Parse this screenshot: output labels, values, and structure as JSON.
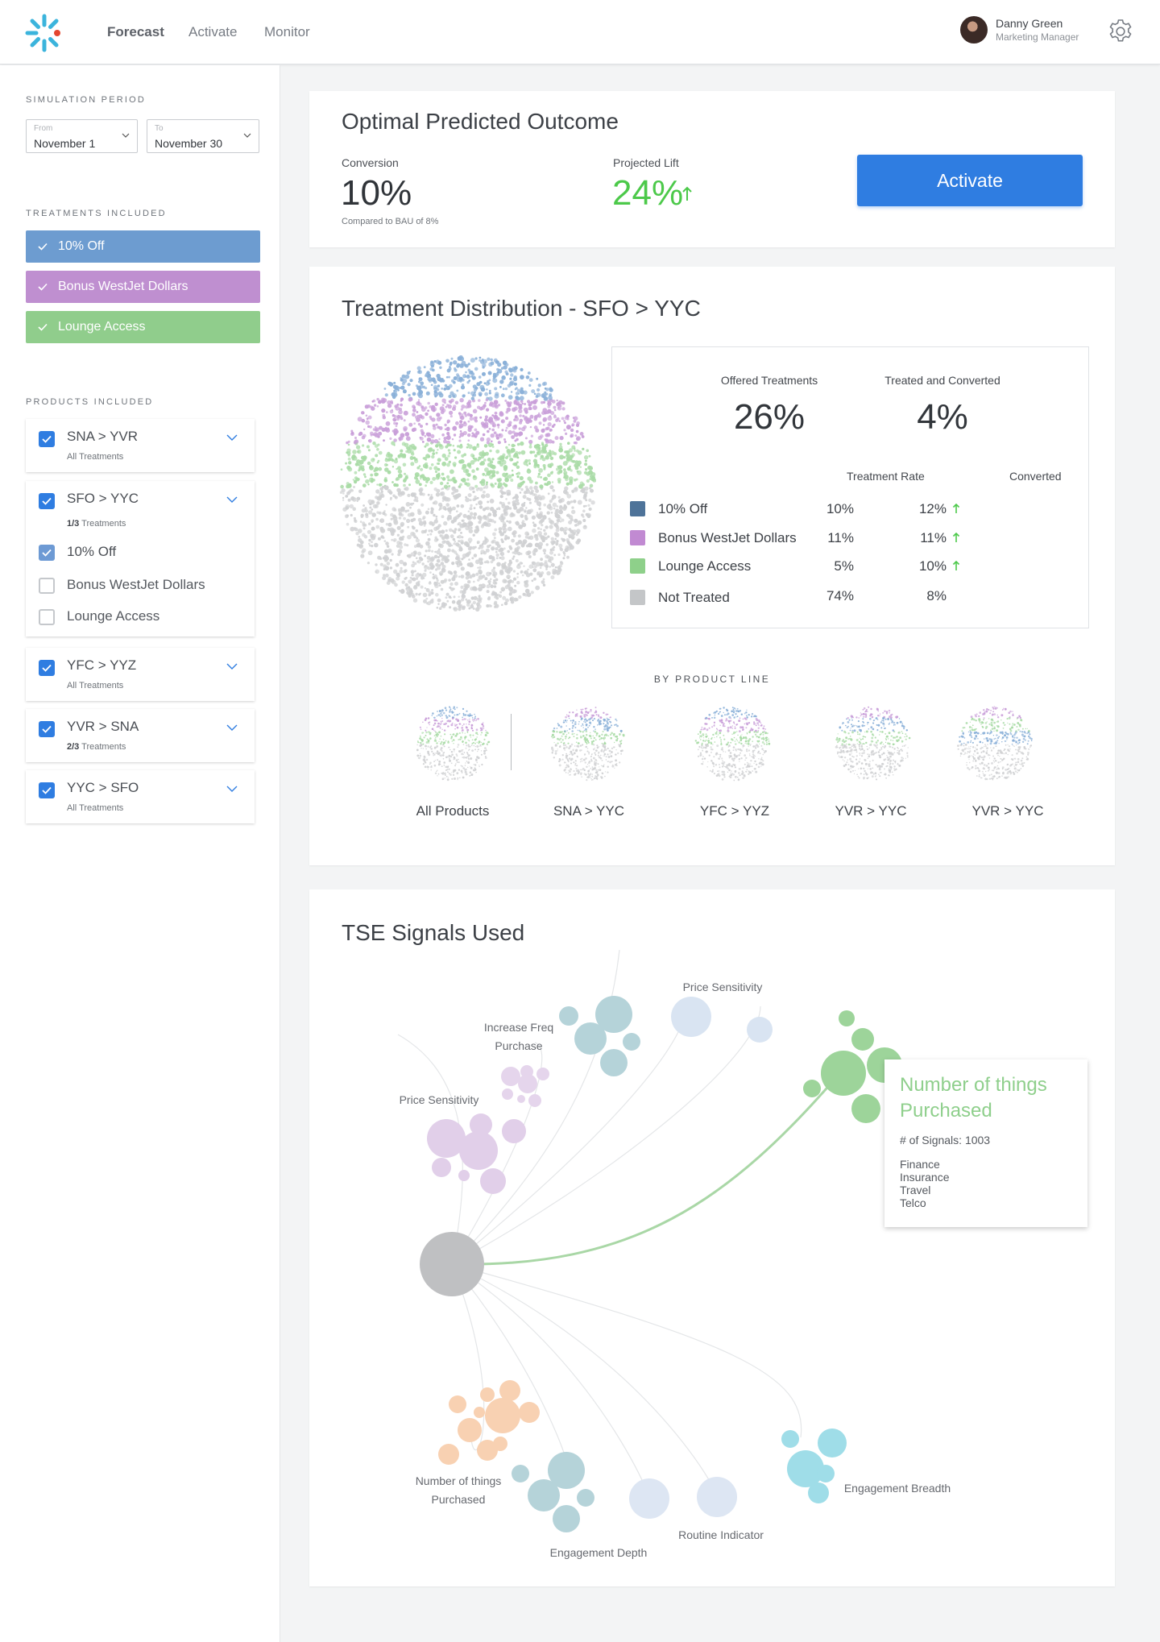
{
  "nav": {
    "items": [
      "Forecast",
      "Activate",
      "Monitor"
    ],
    "active": "Forecast"
  },
  "user": {
    "name": "Danny Green",
    "role": "Marketing Manager"
  },
  "sidebar": {
    "simulation_label": "SIMULATION PERIOD",
    "from_label": "From",
    "from_value": "November 1",
    "to_label": "To",
    "to_value": "November 30",
    "treatments_label": "TREATMENTS INCLUDED",
    "treatments": [
      {
        "label": "10% Off",
        "color": "#6d9cd0"
      },
      {
        "label": "Bonus WestJet Dollars",
        "color": "#bf8fd0"
      },
      {
        "label": "Lounge Access",
        "color": "#90cd8c"
      }
    ],
    "products_label": "PRODUCTS INCLUDED",
    "products": [
      {
        "name": "SNA > YVR",
        "sub": "All Treatments"
      },
      {
        "name": "SFO > YYC",
        "sub_count": "1/3",
        "sub_rest": " Treatments",
        "options": [
          {
            "label": "10% Off",
            "checked": true
          },
          {
            "label": "Bonus WestJet Dollars",
            "checked": false
          },
          {
            "label": "Lounge Access",
            "checked": false
          }
        ]
      },
      {
        "name": "YFC > YYZ",
        "sub": "All Treatments"
      },
      {
        "name": "YVR > SNA",
        "sub_count": "2/3",
        "sub_rest": " Treatments"
      },
      {
        "name": "YYC > SFO",
        "sub": "All Treatments"
      }
    ]
  },
  "outcome": {
    "title": "Optimal Predicted Outcome",
    "conversion_label": "Conversion",
    "conversion_value": "10%",
    "conversion_note": "Compared to BAU of 8%",
    "lift_label": "Projected Lift",
    "lift_value": "24%",
    "activate_label": "Activate",
    "accent": "#2f7de1",
    "positive": "#4cc94a"
  },
  "distribution": {
    "title": "Treatment Distribution - SFO > YYC",
    "offered_label": "Offered Treatments",
    "offered_value": "26%",
    "converted_label": "Treated and Converted",
    "converted_value": "4%",
    "rate_header": "Treatment Rate",
    "converted_header": "Converted",
    "rows": [
      {
        "name": "10% Off",
        "rate": "10%",
        "converted": "12%",
        "up": true,
        "color": "#4e7399"
      },
      {
        "name": "Bonus WestJet Dollars",
        "rate": "11%",
        "converted": "11%",
        "up": true,
        "color": "#c18ad2"
      },
      {
        "name": "Lounge Access",
        "rate": "5%",
        "converted": "10%",
        "up": true,
        "color": "#8ed08a"
      },
      {
        "name": "Not Treated",
        "rate": "74%",
        "converted": "8%",
        "up": false,
        "color": "#c4c6c8"
      }
    ],
    "by_product_label": "BY PRODUCT LINE",
    "product_lines": [
      "All Products",
      "SNA > YYC",
      "YFC > YYZ",
      "YVR > YYC",
      "YVR > YYC"
    ]
  },
  "signals": {
    "title": "TSE Signals Used",
    "labels": {
      "price_top": "Price Sensitivity",
      "increase_freq": "Increase Freq\nPurchase",
      "price_left": "Price Sensitivity",
      "things_bottom": "Number of things\nPurchased",
      "depth": "Engagement Depth",
      "routine": "Routine Indicator",
      "breadth": "Engagement Breadth"
    },
    "tooltip": {
      "title": "Number of things Purchased",
      "count": "# of Signals: 1003",
      "industries": [
        "Finance",
        "Insurance",
        "Travel",
        "Telco"
      ]
    }
  }
}
